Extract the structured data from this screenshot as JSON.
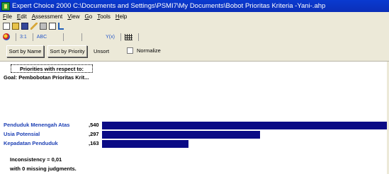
{
  "window": {
    "title": "Expert Choice 2000    C:\\Documents and Settings\\PSMI7\\My Documents\\Bobot Prioritas Kriteria -Yani-.ahp"
  },
  "menu": [
    "File",
    "Edit",
    "Assessment",
    "View",
    "Go",
    "Tools",
    "Help"
  ],
  "toolbar2": {
    "ratio_label": "3:1",
    "abc_label": "ABC",
    "yxy_label": "Y(x)"
  },
  "buttons": {
    "sort_by_name": "Sort by Name",
    "sort_by_priority": "Sort by Priority",
    "unsort": "Unsort",
    "normalize": "Normalize"
  },
  "content": {
    "priorities_header": "Priorities with respect to:",
    "goal": "Goal: Pembobotan Prioritas Krit...",
    "inconsistency": "Inconsistency = 0,01",
    "missing": "with 0  missing judgments."
  },
  "chart_data": {
    "type": "bar",
    "categories": [
      "Penduduk Menengah Atas",
      "Usia Potensial",
      "Kepadatan Penduduk"
    ],
    "value_labels": [
      ",540",
      ",297",
      ",163"
    ],
    "values": [
      0.54,
      0.297,
      0.163
    ],
    "bar_color": "#0b0b85",
    "label_color": "#1c3fb4"
  }
}
